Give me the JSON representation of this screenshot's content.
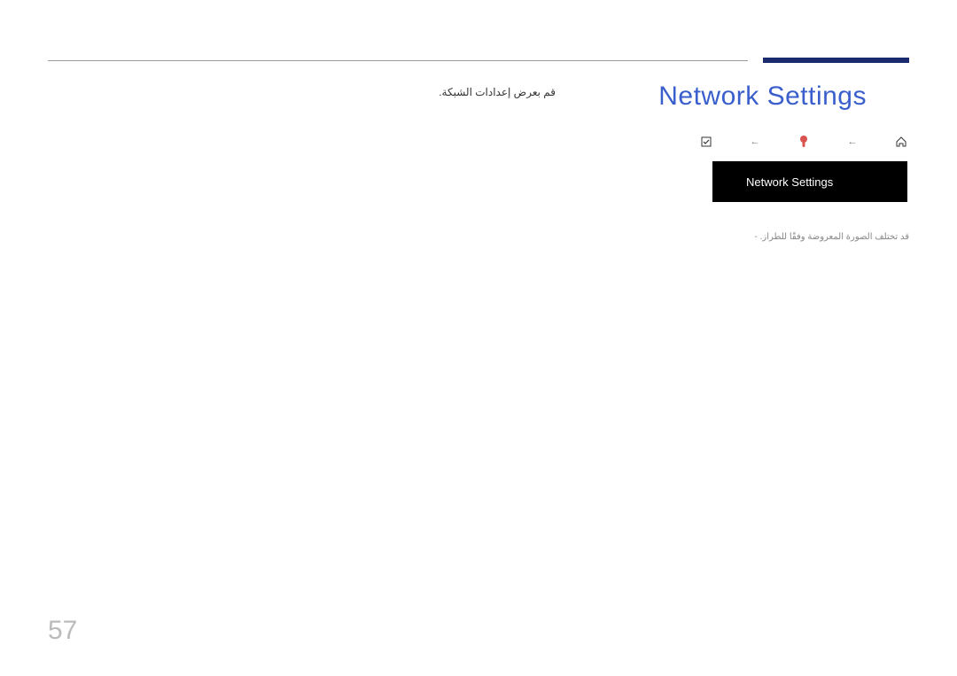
{
  "header": {
    "title": "Network Settings",
    "arabic_desc": "قم بعرض إعدادات الشبكة."
  },
  "breadcrumb": {
    "icons": {
      "expand": "expand-icon",
      "warn": "warn-icon",
      "home": "home-icon"
    }
  },
  "menu": {
    "item_label": "Network Settings"
  },
  "note": {
    "text": "قد تختلف الصورة المعروضة وفقًا للطراز.",
    "dash": "-"
  },
  "page_number": "57"
}
